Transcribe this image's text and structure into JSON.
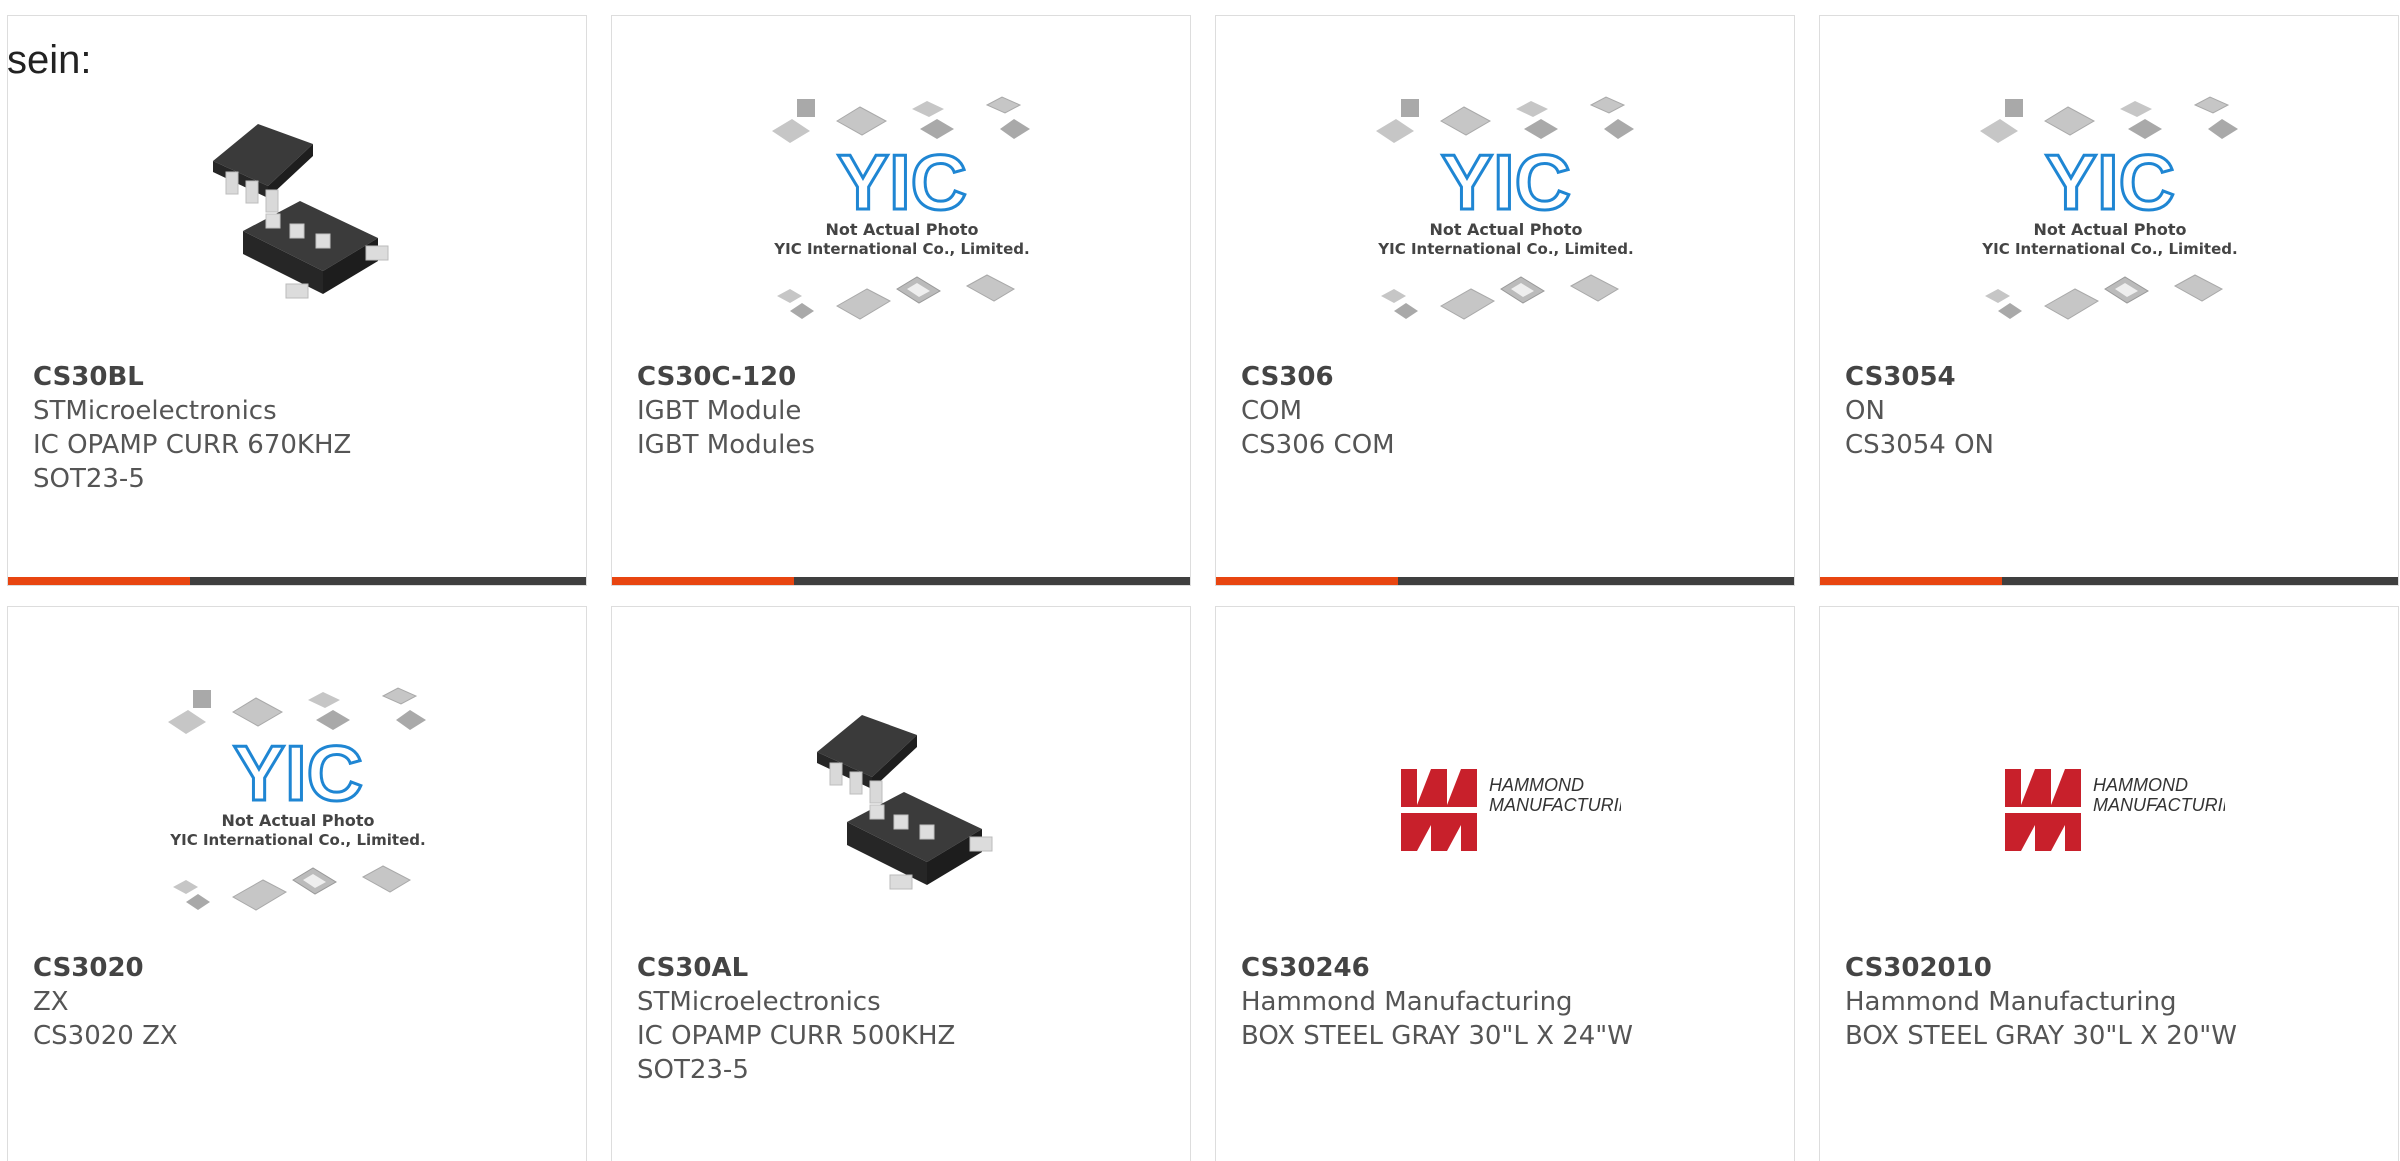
{
  "intro_text": "sein:",
  "colors": {
    "accent": "#e84510",
    "bar": "#3f3f3f",
    "yic_blue": "#1f86d3",
    "hammond_red": "#c8202b"
  },
  "yic_placeholder": {
    "brand": "YIC",
    "line1": "Not Actual Photo",
    "line2": "YIC International Co., Limited."
  },
  "hammond_logo": {
    "line1": "HAMMOND",
    "line2": "MANUFACTURING."
  },
  "products": [
    {
      "part": "CS30BL",
      "maker": "STMicroelectronics",
      "desc": "IC OPAMP CURR 670KHZ SOT23-5",
      "image": "sot23-5-chip-icon"
    },
    {
      "part": "CS30C-120",
      "maker": "IGBT Module",
      "desc": "IGBT Modules",
      "image": "yic-placeholder-icon"
    },
    {
      "part": "CS306",
      "maker": "COM",
      "desc": "CS306 COM",
      "image": "yic-placeholder-icon"
    },
    {
      "part": "CS3054",
      "maker": "ON",
      "desc": "CS3054 ON",
      "image": "yic-placeholder-icon"
    },
    {
      "part": "CS3020",
      "maker": "ZX",
      "desc": "CS3020 ZX",
      "image": "yic-placeholder-icon"
    },
    {
      "part": "CS30AL",
      "maker": "STMicroelectronics",
      "desc": "IC OPAMP CURR 500KHZ SOT23-5",
      "image": "sot23-5-chip-icon"
    },
    {
      "part": "CS30246",
      "maker": "Hammond Manufacturing",
      "desc": "BOX STEEL GRAY 30\"L X 24\"W",
      "image": "hammond-logo-icon"
    },
    {
      "part": "CS302010",
      "maker": "Hammond Manufacturing",
      "desc": "BOX STEEL GRAY 30\"L X 20\"W",
      "image": "hammond-logo-icon"
    }
  ]
}
